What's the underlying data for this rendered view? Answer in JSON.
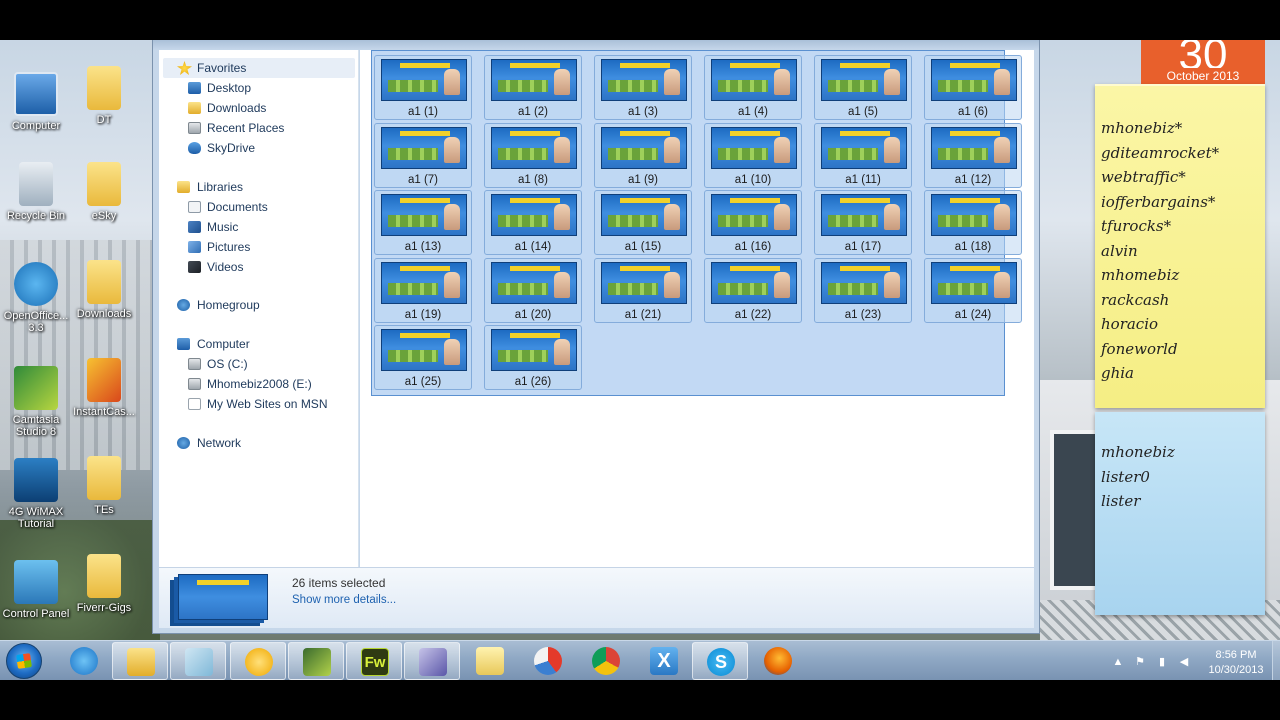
{
  "desktop": {
    "icons": [
      {
        "label": "Computer"
      },
      {
        "label": "DT"
      },
      {
        "label": "Recycle Bin"
      },
      {
        "label": "eSky"
      },
      {
        "label": "OpenOffice... 3.3"
      },
      {
        "label": "Downloads"
      },
      {
        "label": "Camtasia Studio 8"
      },
      {
        "label": "InstantCas..."
      },
      {
        "label": "4G WiMAX Tutorial"
      },
      {
        "label": "TEs"
      },
      {
        "label": "Control Panel"
      },
      {
        "label": "Fiverr-Gigs"
      }
    ]
  },
  "calendar": {
    "day": "30",
    "month": "October 2013"
  },
  "sticky_notes": [
    {
      "lines": [
        "mhonebiz*",
        "gditeamrocket*",
        "webtraffic*",
        "iofferbargains*",
        "tfurocks*",
        "alvin",
        "mhomebiz",
        "rackcash",
        "horacio",
        "foneworld",
        "ghia"
      ]
    },
    {
      "lines": [
        "mhonebiz",
        "lister0",
        "lister"
      ]
    }
  ],
  "nav": {
    "favorites": "Favorites",
    "desktop": "Desktop",
    "downloads": "Downloads",
    "recent_places": "Recent Places",
    "skydrive": "SkyDrive",
    "libraries": "Libraries",
    "documents": "Documents",
    "music": "Music",
    "pictures": "Pictures",
    "videos": "Videos",
    "homegroup": "Homegroup",
    "computer": "Computer",
    "os_c": "OS (C:)",
    "mhomebiz_e": "Mhomebiz2008 (E:)",
    "my_web_sites": "My Web Sites on MSN",
    "network": "Network"
  },
  "files": [
    "a1 (1)",
    "a1 (2)",
    "a1 (3)",
    "a1 (4)",
    "a1 (5)",
    "a1 (6)",
    "a1 (7)",
    "a1 (8)",
    "a1 (9)",
    "a1 (10)",
    "a1 (11)",
    "a1 (12)",
    "a1 (13)",
    "a1 (14)",
    "a1 (15)",
    "a1 (16)",
    "a1 (17)",
    "a1 (18)",
    "a1 (19)",
    "a1 (20)",
    "a1 (21)",
    "a1 (22)",
    "a1 (23)",
    "a1 (24)",
    "a1 (25)",
    "a1 (26)"
  ],
  "details": {
    "count": "26 items selected",
    "more": "Show more details..."
  },
  "taskbar": {
    "fw_label": "Fw",
    "x_label": "X",
    "skype_label": "S"
  },
  "clock": {
    "time": "8:56 PM",
    "date": "10/30/2013"
  }
}
